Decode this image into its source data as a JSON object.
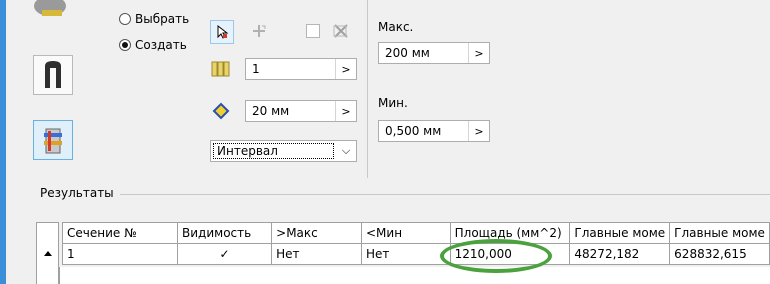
{
  "mode": {
    "select_label": "Выбрать",
    "create_label": "Создать",
    "selected": "create"
  },
  "count": {
    "value": "1"
  },
  "thickness": {
    "value": "20 мм"
  },
  "interval": {
    "value": "Интервал"
  },
  "max": {
    "label": "Макс.",
    "value": "200 мм"
  },
  "min": {
    "label": "Мин.",
    "value": "0,500 мм"
  },
  "results": {
    "label": "Результаты",
    "columns": [
      "Сечение №",
      "Видимость",
      ">Макс",
      "<Мин",
      "Площадь (мм^2)",
      "Главные моме",
      "Главные моме"
    ],
    "rows": [
      {
        "section": "1",
        "visibility": "✓",
        "max": "Нет",
        "min": "Нет",
        "area": "1210,000",
        "moment1": "48272,182",
        "moment2": "628832,615"
      }
    ]
  },
  "colors": {
    "accent": "#3a8fd8",
    "highlight": "#4aa23c"
  },
  "icons": [
    "select-arrow-icon",
    "move-icon",
    "checkbox-icon",
    "cut-icon",
    "layers-icon",
    "thickness-icon"
  ]
}
